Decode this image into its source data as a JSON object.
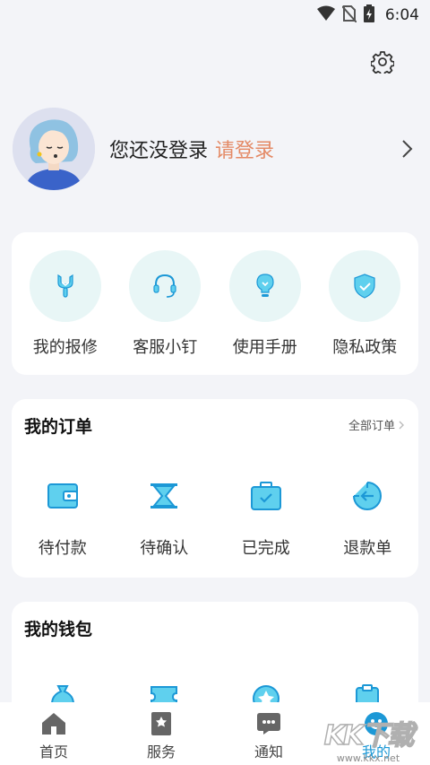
{
  "status_bar": {
    "time": "6:04",
    "icons": [
      "wifi-icon",
      "no-sim-icon",
      "battery-charging-icon"
    ]
  },
  "header": {
    "settings_icon": "gear-icon"
  },
  "profile": {
    "status_text": "您还没登录",
    "login_link": "请登录",
    "chevron_icon": "chevron-right-icon"
  },
  "tools": [
    {
      "label": "我的报修",
      "icon": "wrench-icon"
    },
    {
      "label": "客服小钉",
      "icon": "headset-icon"
    },
    {
      "label": "使用手册",
      "icon": "lightbulb-icon"
    },
    {
      "label": "隐私政策",
      "icon": "shield-check-icon"
    }
  ],
  "orders": {
    "title": "我的订单",
    "more": "全部订单",
    "items": [
      {
        "label": "待付款",
        "icon": "wallet-icon"
      },
      {
        "label": "待确认",
        "icon": "hourglass-icon"
      },
      {
        "label": "已完成",
        "icon": "briefcase-check-icon"
      },
      {
        "label": "退款单",
        "icon": "refund-icon"
      }
    ]
  },
  "wallet": {
    "title": "我的钱包",
    "icons": [
      "money-bag-icon",
      "ticket-icon",
      "star-coin-icon",
      "clipboard-icon"
    ]
  },
  "tab_bar": {
    "items": [
      {
        "label": "首页",
        "icon": "home-icon",
        "active": false
      },
      {
        "label": "服务",
        "icon": "service-bookmark-icon",
        "active": false
      },
      {
        "label": "通知",
        "icon": "chat-bubble-icon",
        "active": false
      },
      {
        "label": "我的",
        "icon": "profile-smile-icon",
        "active": true
      }
    ]
  },
  "watermark": {
    "logo": "KK下载",
    "url": "www.kkx.net"
  },
  "colors": {
    "accent": "#1c98d6",
    "icon_fill": "#5fd0ee",
    "login_link": "#e48a66",
    "tool_circle_bg": "#e8f6f6",
    "page_bg": "#f3f4f8"
  }
}
